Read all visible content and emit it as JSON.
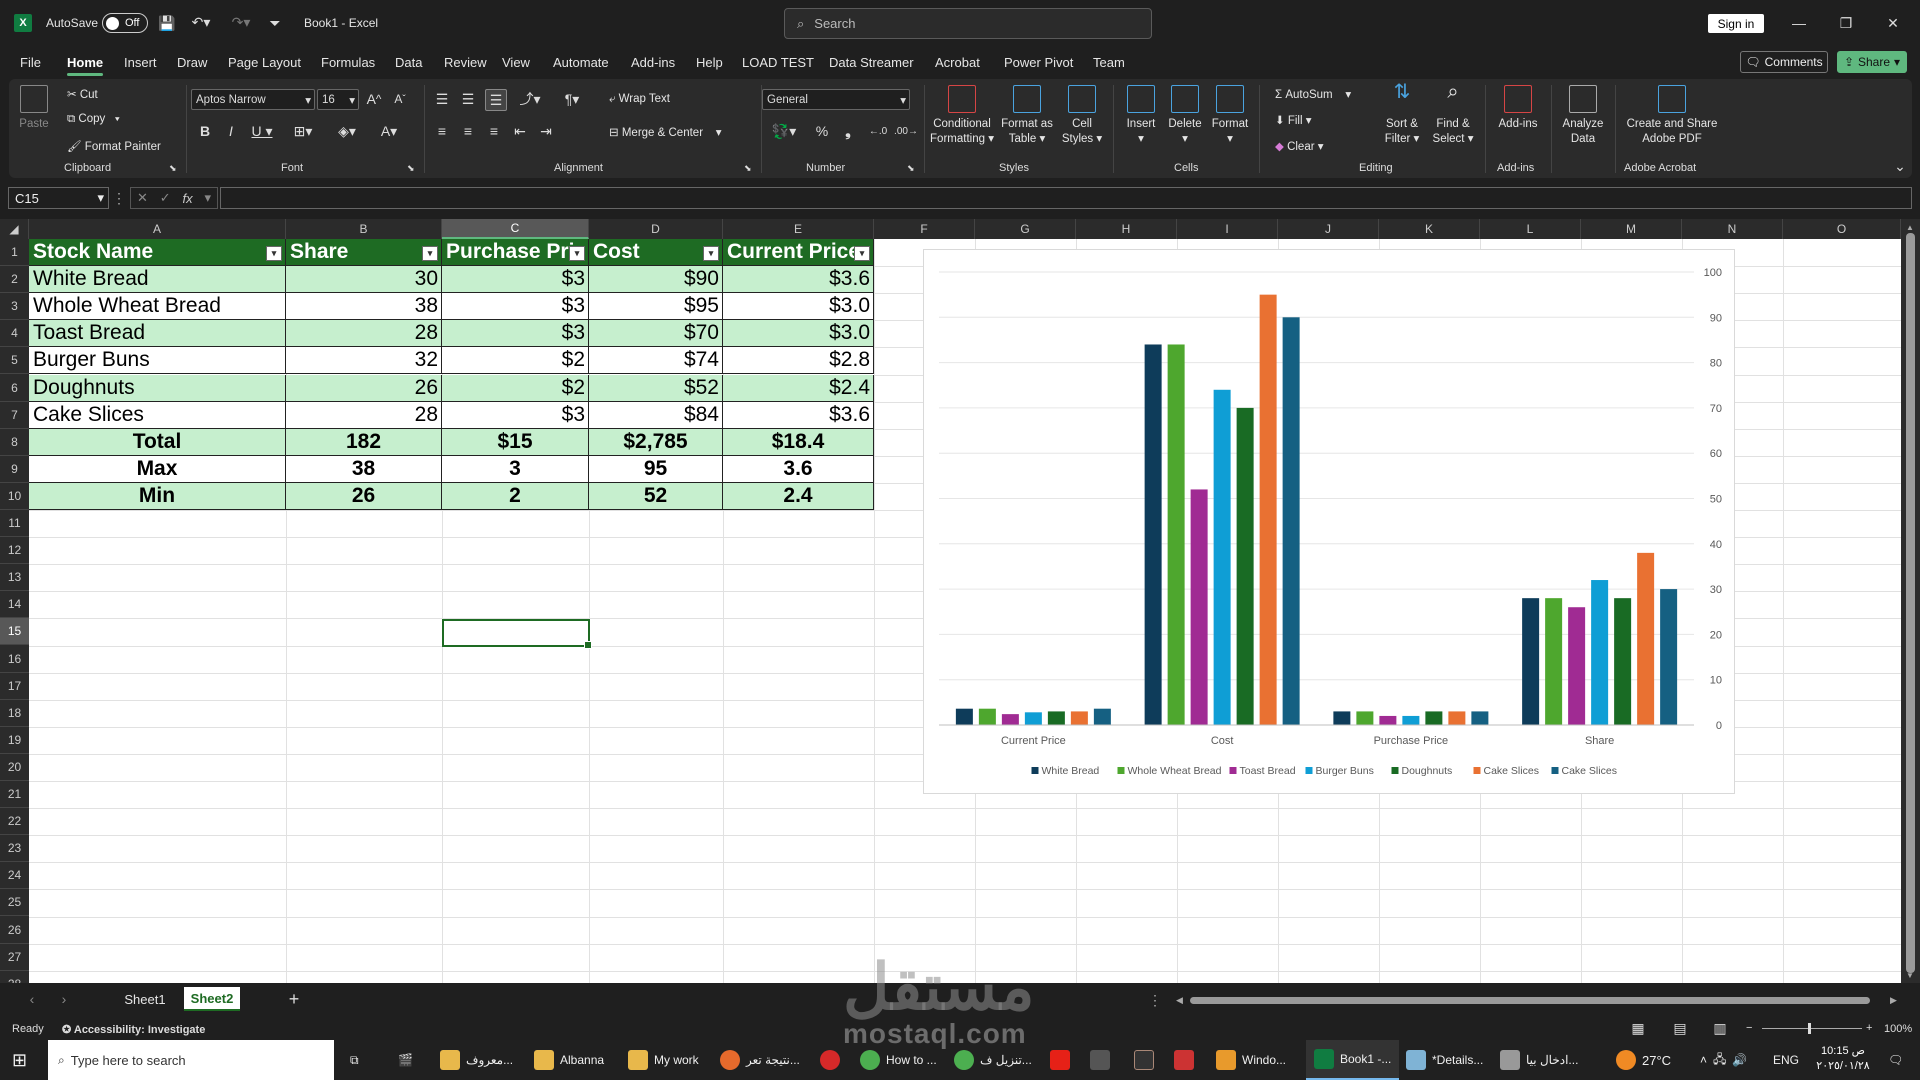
{
  "titlebar": {
    "autosave_label": "AutoSave",
    "autosave_state": "Off",
    "doc_title": "Book1  -  Excel",
    "search_placeholder": "Search",
    "signin_label": "Sign in"
  },
  "menu": {
    "tabs": [
      "File",
      "Home",
      "Insert",
      "Draw",
      "Page Layout",
      "Formulas",
      "Data",
      "Review",
      "View",
      "Automate",
      "Add-ins",
      "Help",
      "LOAD TEST",
      "Data Streamer",
      "Acrobat",
      "Power Pivot",
      "Team"
    ],
    "active": "Home",
    "comments_label": "Comments",
    "share_label": "Share"
  },
  "ribbon": {
    "clipboard": {
      "paste": "Paste",
      "cut": "Cut",
      "copy": "Copy",
      "format_painter": "Format Painter",
      "label": "Clipboard"
    },
    "font": {
      "name": "Aptos Narrow",
      "size": "16",
      "label": "Font"
    },
    "alignment": {
      "wrap": "Wrap Text",
      "merge": "Merge & Center",
      "label": "Alignment"
    },
    "number": {
      "format": "General",
      "label": "Number"
    },
    "styles": {
      "conditional": "Conditional",
      "conditional2": "Formatting",
      "format_table": "Format as",
      "format_table2": "Table",
      "cell_styles": "Cell",
      "cell_styles2": "Styles",
      "label": "Styles"
    },
    "cells": {
      "insert": "Insert",
      "delete": "Delete",
      "format": "Format",
      "label": "Cells"
    },
    "editing": {
      "autosum": "AutoSum",
      "fill": "Fill",
      "clear": "Clear",
      "sort": "Sort &",
      "sort2": "Filter",
      "find": "Find &",
      "find2": "Select",
      "label": "Editing"
    },
    "addins": {
      "addins": "Add-ins",
      "label": "Add-ins"
    },
    "analyze": {
      "a1": "Analyze",
      "a2": "Data"
    },
    "acrobat": {
      "c1": "Create and Share",
      "c2": "Adobe PDF",
      "label": "Adobe Acrobat"
    }
  },
  "formula_bar": {
    "name_box": "C15",
    "fx": "fx",
    "formula": ""
  },
  "columns": [
    "A",
    "B",
    "C",
    "D",
    "E",
    "F",
    "G",
    "H",
    "I",
    "J",
    "K",
    "L",
    "M",
    "N",
    "O"
  ],
  "rows": [
    "1",
    "2",
    "3",
    "4",
    "5",
    "6",
    "7",
    "8",
    "9",
    "10",
    "11",
    "12",
    "13",
    "14",
    "15",
    "16",
    "17",
    "18",
    "19",
    "20",
    "21",
    "22",
    "23",
    "24",
    "25",
    "26",
    "27",
    "28"
  ],
  "table": {
    "headers": [
      "Stock Name",
      "Share",
      "Purchase Pri",
      "Cost",
      "Current Price"
    ],
    "rows": [
      [
        "White Bread",
        "30",
        "$3",
        "$90",
        "$3.6"
      ],
      [
        "Whole Wheat Bread",
        "38",
        "$3",
        "$95",
        "$3.0"
      ],
      [
        "Toast Bread",
        "28",
        "$3",
        "$70",
        "$3.0"
      ],
      [
        "Burger Buns",
        "32",
        "$2",
        "$74",
        "$2.8"
      ],
      [
        "Doughnuts",
        "26",
        "$2",
        "$52",
        "$2.4"
      ],
      [
        "Cake Slices",
        "28",
        "$3",
        "$84",
        "$3.6"
      ]
    ],
    "summary": [
      [
        "Total",
        "182",
        "$15",
        "$2,785",
        "$18.4"
      ],
      [
        "Max",
        "38",
        "3",
        "95",
        "3.6"
      ],
      [
        "Min",
        "26",
        "2",
        "52",
        "2.4"
      ]
    ]
  },
  "chart_data": {
    "type": "bar",
    "categories": [
      "Current Price",
      "Cost",
      "Purchase Price",
      "Share"
    ],
    "series": [
      {
        "name": "White Bread",
        "color": "#0e3c5a",
        "values": [
          3.6,
          84,
          3,
          28
        ]
      },
      {
        "name": "Whole Wheat Bread",
        "color": "#4ea72e",
        "values": [
          3.6,
          84,
          3,
          28
        ]
      },
      {
        "name": "Toast Bread",
        "color": "#a02b93",
        "values": [
          2.4,
          52,
          2,
          26
        ]
      },
      {
        "name": "Burger Buns",
        "color": "#0f9ed5",
        "values": [
          2.8,
          74,
          2,
          32
        ]
      },
      {
        "name": "Doughnuts",
        "color": "#196b24",
        "values": [
          3.0,
          70,
          3,
          28
        ]
      },
      {
        "name": "Cake Slices",
        "color": "#e97132",
        "values": [
          3.0,
          95,
          3,
          38
        ]
      },
      {
        "name": "Cake Slices",
        "color": "#156082",
        "values": [
          3.6,
          90,
          3,
          30
        ]
      }
    ],
    "ylim": [
      0,
      100
    ],
    "yticks": [
      "0",
      "10",
      "20",
      "30",
      "40",
      "50",
      "60",
      "70",
      "80",
      "90",
      "100"
    ],
    "y_axis_side": "right",
    "grid": true,
    "legend_position": "bottom",
    "title": "",
    "xlabel": "",
    "ylabel": ""
  },
  "sheets": {
    "tabs": [
      "Sheet1",
      "Sheet2"
    ],
    "active": "Sheet2",
    "add": "+"
  },
  "status": {
    "ready": "Ready",
    "accessibility": "Accessibility: Investigate",
    "zoom": "100%"
  },
  "taskbar": {
    "search_placeholder": "Type here to search",
    "items": [
      "معروف...",
      "Albanna",
      "My work",
      "نتيجة تعر...",
      "How to ...",
      "تنزيل ف...",
      "Windo...",
      "Book1 -...",
      "*Details...",
      "ادخال بيا..."
    ],
    "temp": "27°C",
    "lang": "ENG",
    "time": "10:15 ص",
    "date": "٢٠٢٥/٠١/٢٨"
  },
  "watermark": {
    "text": "مستقل",
    "url": "mostaql.com"
  }
}
